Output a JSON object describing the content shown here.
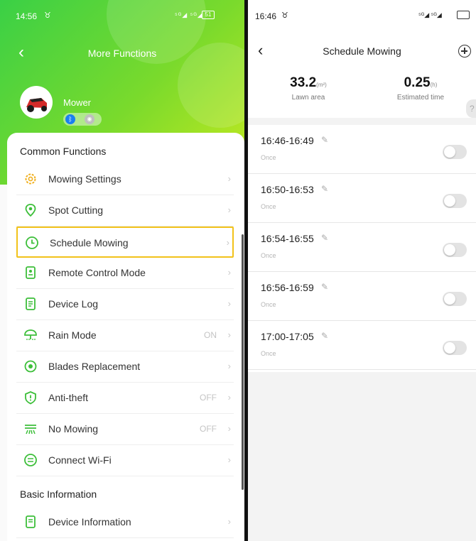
{
  "left": {
    "status": {
      "time": "14:56",
      "alarm": "♉",
      "signal": "⁵ᴳ◢ ⁵ᴳ◢",
      "battery": "51"
    },
    "nav": {
      "back": "‹",
      "title": "More Functions"
    },
    "device": {
      "name": "Mower",
      "bluetooth_icon": "bluetooth-icon",
      "wifi_icon": "wifi-icon"
    },
    "common_title": "Common Functions",
    "items": [
      {
        "label": "Mowing Settings",
        "value": "",
        "icon": "gear-icon",
        "color": "#f0b020",
        "highlight": false
      },
      {
        "label": "Spot Cutting",
        "value": "",
        "icon": "location-pin-icon",
        "color": "#3dbf3a",
        "highlight": false
      },
      {
        "label": "Schedule Mowing",
        "value": "",
        "icon": "clock-icon",
        "color": "#3dbf3a",
        "highlight": true
      },
      {
        "label": "Remote Control Mode",
        "value": "",
        "icon": "remote-control-icon",
        "color": "#3dbf3a",
        "highlight": false
      },
      {
        "label": "Device Log",
        "value": "",
        "icon": "document-icon",
        "color": "#3dbf3a",
        "highlight": false
      },
      {
        "label": "Rain Mode",
        "value": "ON",
        "icon": "umbrella-icon",
        "color": "#3dbf3a",
        "highlight": false
      },
      {
        "label": "Blades Replacement",
        "value": "",
        "icon": "blade-icon",
        "color": "#3dbf3a",
        "highlight": false
      },
      {
        "label": "Anti-theft",
        "value": "OFF",
        "icon": "shield-icon",
        "color": "#3dbf3a",
        "highlight": false
      },
      {
        "label": "No Mowing",
        "value": "OFF",
        "icon": "grass-off-icon",
        "color": "#3dbf3a",
        "highlight": false
      },
      {
        "label": "Connect Wi-Fi",
        "value": "",
        "icon": "wifi-connect-icon",
        "color": "#3dbf3a",
        "highlight": false
      }
    ],
    "basic_title": "Basic Information",
    "basic_items": [
      {
        "label": "Device Information",
        "value": "",
        "icon": "device-info-icon",
        "color": "#3dbf3a"
      }
    ],
    "chevron": "›"
  },
  "right": {
    "status": {
      "time": "16:46",
      "alarm": "♉",
      "signal": "⁵ᴳ◢ ⁵ᴳ◢"
    },
    "nav": {
      "back": "‹",
      "title": "Schedule Mowing",
      "add_icon": "add-circle-icon"
    },
    "lawn_area": {
      "value": "33.2",
      "unit": "(m²)",
      "caption": "Lawn area"
    },
    "estimated_time": {
      "value": "0.25",
      "unit": "(h)",
      "caption": "Estimated time"
    },
    "help": "?",
    "schedules": [
      {
        "range": "16:46-16:49",
        "freq": "Once",
        "enabled": false
      },
      {
        "range": "16:50-16:53",
        "freq": "Once",
        "enabled": false
      },
      {
        "range": "16:54-16:55",
        "freq": "Once",
        "enabled": false
      },
      {
        "range": "16:56-16:59",
        "freq": "Once",
        "enabled": false
      },
      {
        "range": "17:00-17:05",
        "freq": "Once",
        "enabled": false
      }
    ],
    "pencil": "✎"
  },
  "colors": {
    "accent_green": "#3dbf3a",
    "highlight_border": "#f2c21a",
    "bluetooth": "#1a7ff0"
  }
}
